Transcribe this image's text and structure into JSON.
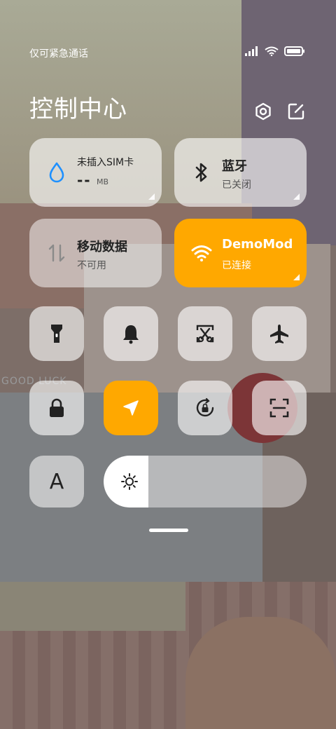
{
  "status": {
    "carrier": "仅可紧急通话",
    "wallpaper_text": "GOOD LUCK"
  },
  "header": {
    "title": "控制中心"
  },
  "tiles": {
    "sim": {
      "label": "未插入SIM卡",
      "value": "--",
      "unit": "MB",
      "icon": "water-drop-icon"
    },
    "bluetooth": {
      "label": "蓝牙",
      "status": "已关闭",
      "icon": "bluetooth-icon"
    },
    "mobile_data": {
      "label": "移动数据",
      "status": "不可用",
      "icon": "data-arrows-icon"
    },
    "wifi": {
      "label": "DemoMod",
      "status": "已连接",
      "icon": "wifi-icon"
    }
  },
  "toggles": [
    {
      "name": "flashlight",
      "on": false
    },
    {
      "name": "ring",
      "on": false
    },
    {
      "name": "screenshot",
      "on": false
    },
    {
      "name": "airplane",
      "on": false
    },
    {
      "name": "lock",
      "on": false
    },
    {
      "name": "location",
      "on": true
    },
    {
      "name": "rotation-lock",
      "on": false
    },
    {
      "name": "scanner",
      "on": false
    }
  ],
  "brightness": {
    "auto_label": "A",
    "level": 0.22
  },
  "colors": {
    "accent": "#ffa800",
    "tile_bg": "rgba(255,255,255,0.62)"
  }
}
